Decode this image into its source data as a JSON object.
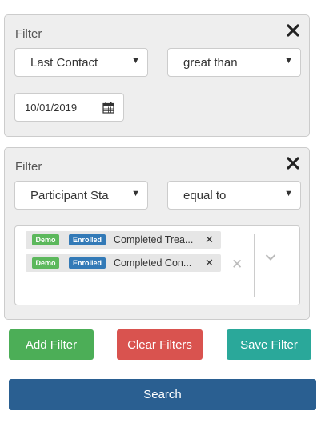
{
  "filter1": {
    "title": "Filter",
    "field": "Last Contact",
    "operator": "great than",
    "date_value": "10/01/2019"
  },
  "filter2": {
    "title": "Filter",
    "field": "Participant Sta",
    "operator": "equal to",
    "chips": [
      {
        "badge1": "Demo",
        "badge2": "Enrolled",
        "text": "Completed Trea..."
      },
      {
        "badge1": "Demo",
        "badge2": "Enrolled",
        "text": "Completed Con..."
      }
    ]
  },
  "buttons": {
    "add": "Add Filter",
    "clear": "Clear Filters",
    "save": "Save Filter",
    "search": "Search"
  },
  "icons": {
    "close": "close-icon",
    "caret": "caret-down-icon",
    "calendar": "calendar-icon",
    "chip_remove": "remove-icon",
    "clear_all": "clear-all-icon",
    "dropdown": "chevron-down-icon"
  },
  "colors": {
    "add_button": "#4cae57",
    "clear_button": "#d9534f",
    "save_button": "#2aa89a",
    "search_button": "#2a5f91",
    "demo_badge": "#5cb85c",
    "enrolled_badge": "#337ab7"
  }
}
